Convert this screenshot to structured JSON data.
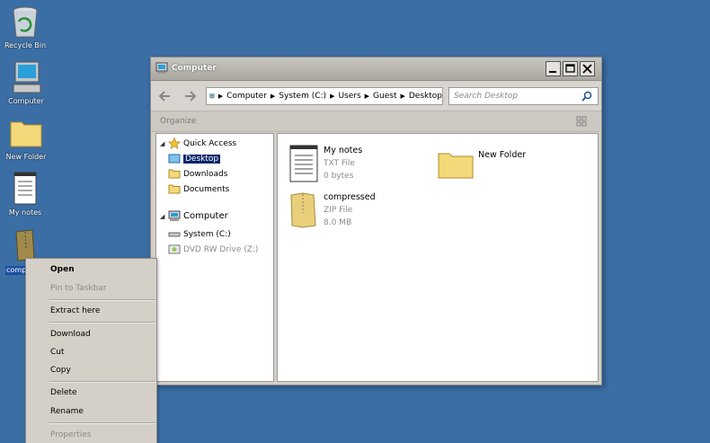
{
  "desktop": {
    "icons": [
      {
        "name": "recycle-bin",
        "label": "Recycle Bin"
      },
      {
        "name": "computer",
        "label": "Computer"
      },
      {
        "name": "new-folder",
        "label": "New Folder"
      },
      {
        "name": "my-notes",
        "label": "My notes"
      },
      {
        "name": "compressed",
        "label": "comp"
      }
    ]
  },
  "window": {
    "title": "Computer",
    "address": {
      "crumbs": [
        "Computer",
        "System (C:)",
        "Users",
        "Guest",
        "Desktop"
      ]
    },
    "search_placeholder": "Search Desktop",
    "organize_label": "Organize",
    "nav": {
      "quick_access": "Quick Access",
      "desktop": "Desktop",
      "downloads": "Downloads",
      "documents": "Documents",
      "computer": "Computer",
      "system_drive": "System (C:)",
      "dvd_drive": "DVD RW Drive (Z:)"
    },
    "files": [
      {
        "name": "My notes",
        "type": "TXT File",
        "size": "0 bytes"
      },
      {
        "name": "New Folder",
        "type": "",
        "size": ""
      },
      {
        "name": "compressed",
        "type": "ZIP File",
        "size": "8.0 MB"
      }
    ]
  },
  "context_menu": {
    "items": [
      "Open",
      "Pin to Taskbar",
      "Extract here",
      "Download",
      "Cut",
      "Copy",
      "Delete",
      "Rename",
      "Properties"
    ]
  },
  "colors": {
    "desktop_bg": "#3b6ea5",
    "selection": "#0a246a"
  },
  "icons": {
    "back": "back-arrow-icon",
    "forward": "forward-arrow-icon",
    "search": "search-icon",
    "view": "view-options-icon"
  }
}
